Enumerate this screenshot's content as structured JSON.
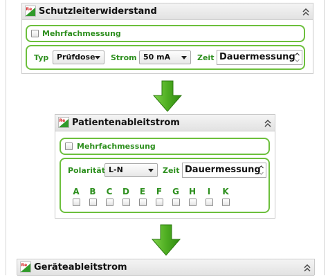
{
  "panels": {
    "protective_conductor": {
      "title": "Schutzleiterwiderstand",
      "multi_label": "Mehrfachmessung",
      "type_label": "Typ",
      "type_value": "Prüfdose",
      "current_label": "Strom",
      "current_value": "50 mA",
      "time_label": "Zeit",
      "time_value": "Dauermessung"
    },
    "patient_leakage": {
      "title": "Patientenableitstrom",
      "multi_label": "Mehrfachmessung",
      "polarity_label": "Polarität",
      "polarity_value": "L-N",
      "time_label": "Zeit",
      "time_value": "Dauermessung",
      "channels": [
        "A",
        "B",
        "C",
        "D",
        "E",
        "F",
        "G",
        "H",
        "I",
        "K"
      ]
    },
    "device_leakage": {
      "title": "Geräteableitstrom"
    }
  },
  "colors": {
    "accent_green": "#6cbf3c",
    "label_green": "#2d8f1e",
    "header_bg": "#e9e9e9"
  },
  "icons": {
    "panel_logo": "re-logo-icon",
    "collapse": "double-chevron-up-icon",
    "flow_arrow": "green-down-arrow-icon"
  }
}
